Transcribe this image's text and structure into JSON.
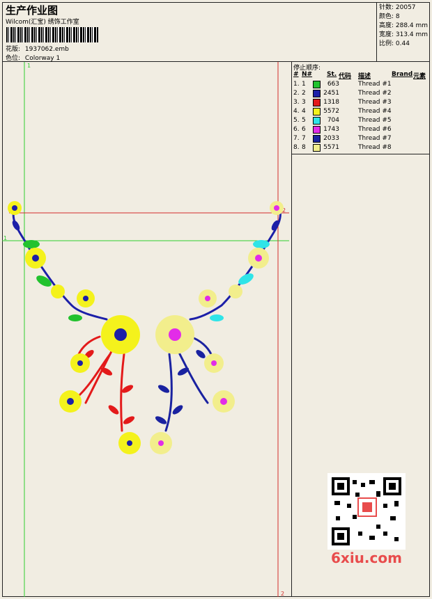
{
  "header": {
    "title": "生产作业图",
    "subtitle": "Wilcom(汇宝) 绣饰工作室",
    "pattern_label": "花版:",
    "pattern_value": "1937062.emb",
    "colorway_label": "色位:",
    "colorway_value": "Colorway 1"
  },
  "stats": {
    "stitches": "针数: 20057",
    "colors": "颜色: 8",
    "height": "高度: 288.4 mm",
    "width": "宽度: 313.4 mm",
    "ratio": "比例: 0.44"
  },
  "threads": {
    "title": "停止顺序:",
    "headers": {
      "index": "#",
      "no": "N#",
      "st": "St.",
      "code": "代码",
      "desc": "描述",
      "brand": "Brand",
      "element": "元素"
    },
    "rows": [
      {
        "index": "1.",
        "no": "1",
        "color": "#22c22e",
        "code": "663",
        "desc": "Thread #1"
      },
      {
        "index": "2.",
        "no": "2",
        "color": "#1c1fa8",
        "code": "2451",
        "desc": "Thread #2"
      },
      {
        "index": "3.",
        "no": "3",
        "color": "#e31a1a",
        "code": "1318",
        "desc": "Thread #3"
      },
      {
        "index": "4.",
        "no": "4",
        "color": "#f4f21c",
        "code": "5572",
        "desc": "Thread #4"
      },
      {
        "index": "5.",
        "no": "5",
        "color": "#2fe4e8",
        "code": "704",
        "desc": "Thread #5"
      },
      {
        "index": "6.",
        "no": "6",
        "color": "#e22ce8",
        "code": "1743",
        "desc": "Thread #6"
      },
      {
        "index": "7.",
        "no": "7",
        "color": "#1a22a0",
        "code": "2033",
        "desc": "Thread #7"
      },
      {
        "index": "8.",
        "no": "8",
        "color": "#f2ee8c",
        "code": "5571",
        "desc": "Thread #8"
      }
    ]
  },
  "guides": {
    "g1": "1",
    "g2": "2"
  },
  "watermark": "6xiu.com",
  "colors": {
    "green_guide": "#2fce2f",
    "red_guide": "#d42a2a",
    "panel_bg": "#f1ede2"
  }
}
